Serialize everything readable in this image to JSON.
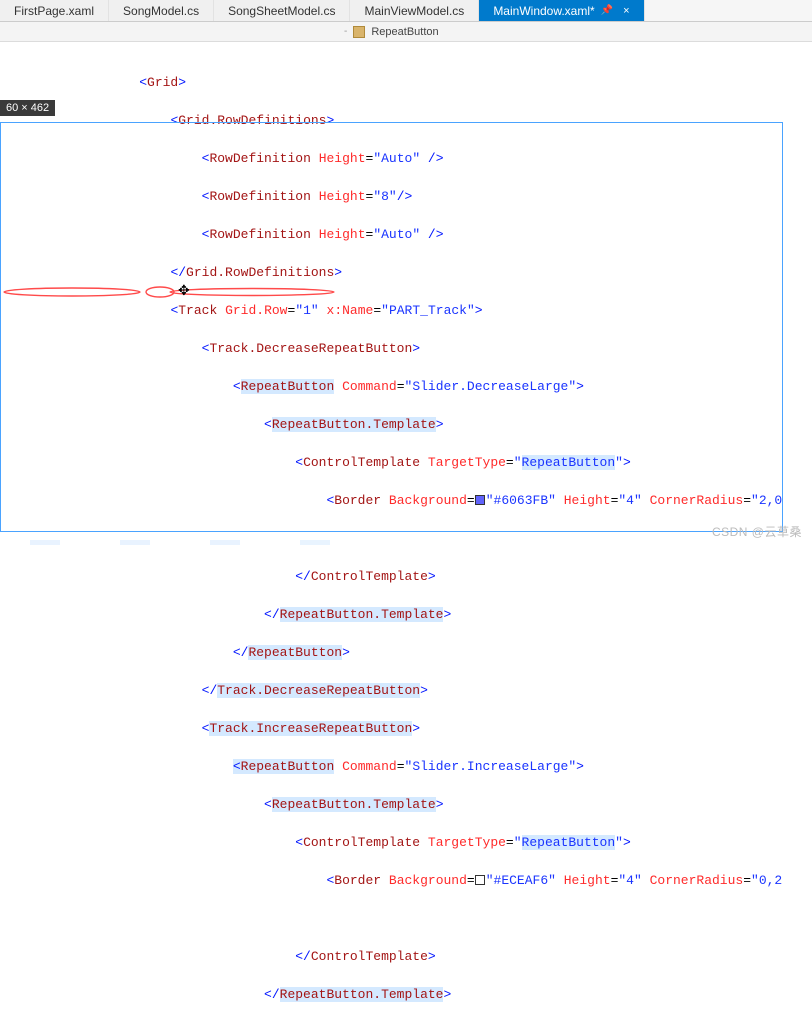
{
  "tabs": [
    {
      "label": "FirstPage.xaml"
    },
    {
      "label": "SongModel.cs"
    },
    {
      "label": "SongSheetModel.cs"
    },
    {
      "label": "MainViewModel.cs"
    },
    {
      "label": "MainWindow.xaml*",
      "active": true,
      "pin": "📌",
      "close": "×"
    }
  ],
  "breadcrumb": {
    "sep": "-",
    "icon": "dd",
    "label": "RepeatButton"
  },
  "sizeBadge": "60 × 462",
  "watermark": "CSDN @云草桑",
  "colors": {
    "decrease": "#6063FB",
    "increase": "#ECEAF6"
  },
  "code": {
    "l1": {
      "open": "<",
      "tag": "Grid",
      "close": ">"
    },
    "l2": {
      "open": "<",
      "tag": "Grid.RowDefinitions",
      "close": ">"
    },
    "l3": {
      "open": "<",
      "tag": "RowDefinition",
      "a1": "Height",
      "v1": "\"Auto\"",
      "slash": " />"
    },
    "l4": {
      "open": "<",
      "tag": "RowDefinition",
      "a1": "Height",
      "v1": "\"8\"",
      "slash": "/>"
    },
    "l5": {
      "open": "<",
      "tag": "RowDefinition",
      "a1": "Height",
      "v1": "\"Auto\"",
      "slash": " />"
    },
    "l6": {
      "open": "</",
      "tag": "Grid.RowDefinitions",
      "close": ">"
    },
    "l7": {
      "open": "<",
      "tag": "Track",
      "a1": "Grid.Row",
      "v1": "\"1\"",
      "a2": "x:Name",
      "v2": "\"PART_Track\"",
      "close": ">"
    },
    "l8": {
      "open": "<",
      "tag": "Track.DecreaseRepeatButton",
      "close": ">"
    },
    "l9": {
      "open": "<",
      "tag": "RepeatButton",
      "a1": "Command",
      "v1": "\"Slider.DecreaseLarge\"",
      "close": ">"
    },
    "l10": {
      "open": "<",
      "tag": "RepeatButton.Template",
      "close": ">"
    },
    "l11": {
      "open": "<",
      "tag": "ControlTemplate",
      "a1": "TargetType",
      "v1": "\"RepeatButton\"",
      "close": ">"
    },
    "l12": {
      "open": "<",
      "tag": "Border",
      "a1": "Background",
      "v1": "\"#6063FB\"",
      "a2": "Height",
      "v2": "\"4\"",
      "a3": "CornerRadius",
      "v3": "\"2,0"
    },
    "l13": {
      "open": "</",
      "tag": "ControlTemplate",
      "close": ">"
    },
    "l14": {
      "open": "</",
      "tag": "RepeatButton.Template",
      "close": ">"
    },
    "l15": {
      "open": "</",
      "tag": "RepeatButton",
      "close": ">"
    },
    "l16": {
      "open": "</",
      "tag": "Track.DecreaseRepeatButton",
      "close": ">"
    },
    "l17": {
      "open": "<",
      "tag": "Track.IncreaseRepeatButton",
      "close": ">"
    },
    "l18": {
      "open": "<",
      "tag": "RepeatButton",
      "a1": "Command",
      "v1": "\"Slider.IncreaseLarge\"",
      "close": ">"
    },
    "l19": {
      "open": "<",
      "tag": "RepeatButton.Template",
      "close": ">"
    },
    "l20": {
      "open": "<",
      "tag": "ControlTemplate",
      "a1": "TargetType",
      "v1": "\"RepeatButton\"",
      "close": ">"
    },
    "l21": {
      "open": "<",
      "tag": "Border",
      "a1": "Background",
      "v1": "\"#ECEAF6\"",
      "a2": "Height",
      "v2": "\"4\"",
      "a3": "CornerRadius",
      "v3": "\"0,2"
    },
    "l22": {
      "open": "</",
      "tag": "ControlTemplate",
      "close": ">"
    },
    "l23": {
      "open": "</",
      "tag": "RepeatButton.Template",
      "close": ">"
    }
  }
}
